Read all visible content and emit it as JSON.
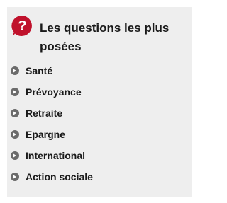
{
  "faq": {
    "title": "Les questions les plus posées",
    "icon": "question-mark-icon",
    "accent_color": "#c0122c",
    "items": [
      {
        "label": "Santé"
      },
      {
        "label": "Prévoyance"
      },
      {
        "label": "Retraite"
      },
      {
        "label": "Epargne"
      },
      {
        "label": "International"
      },
      {
        "label": "Action sociale"
      }
    ]
  }
}
